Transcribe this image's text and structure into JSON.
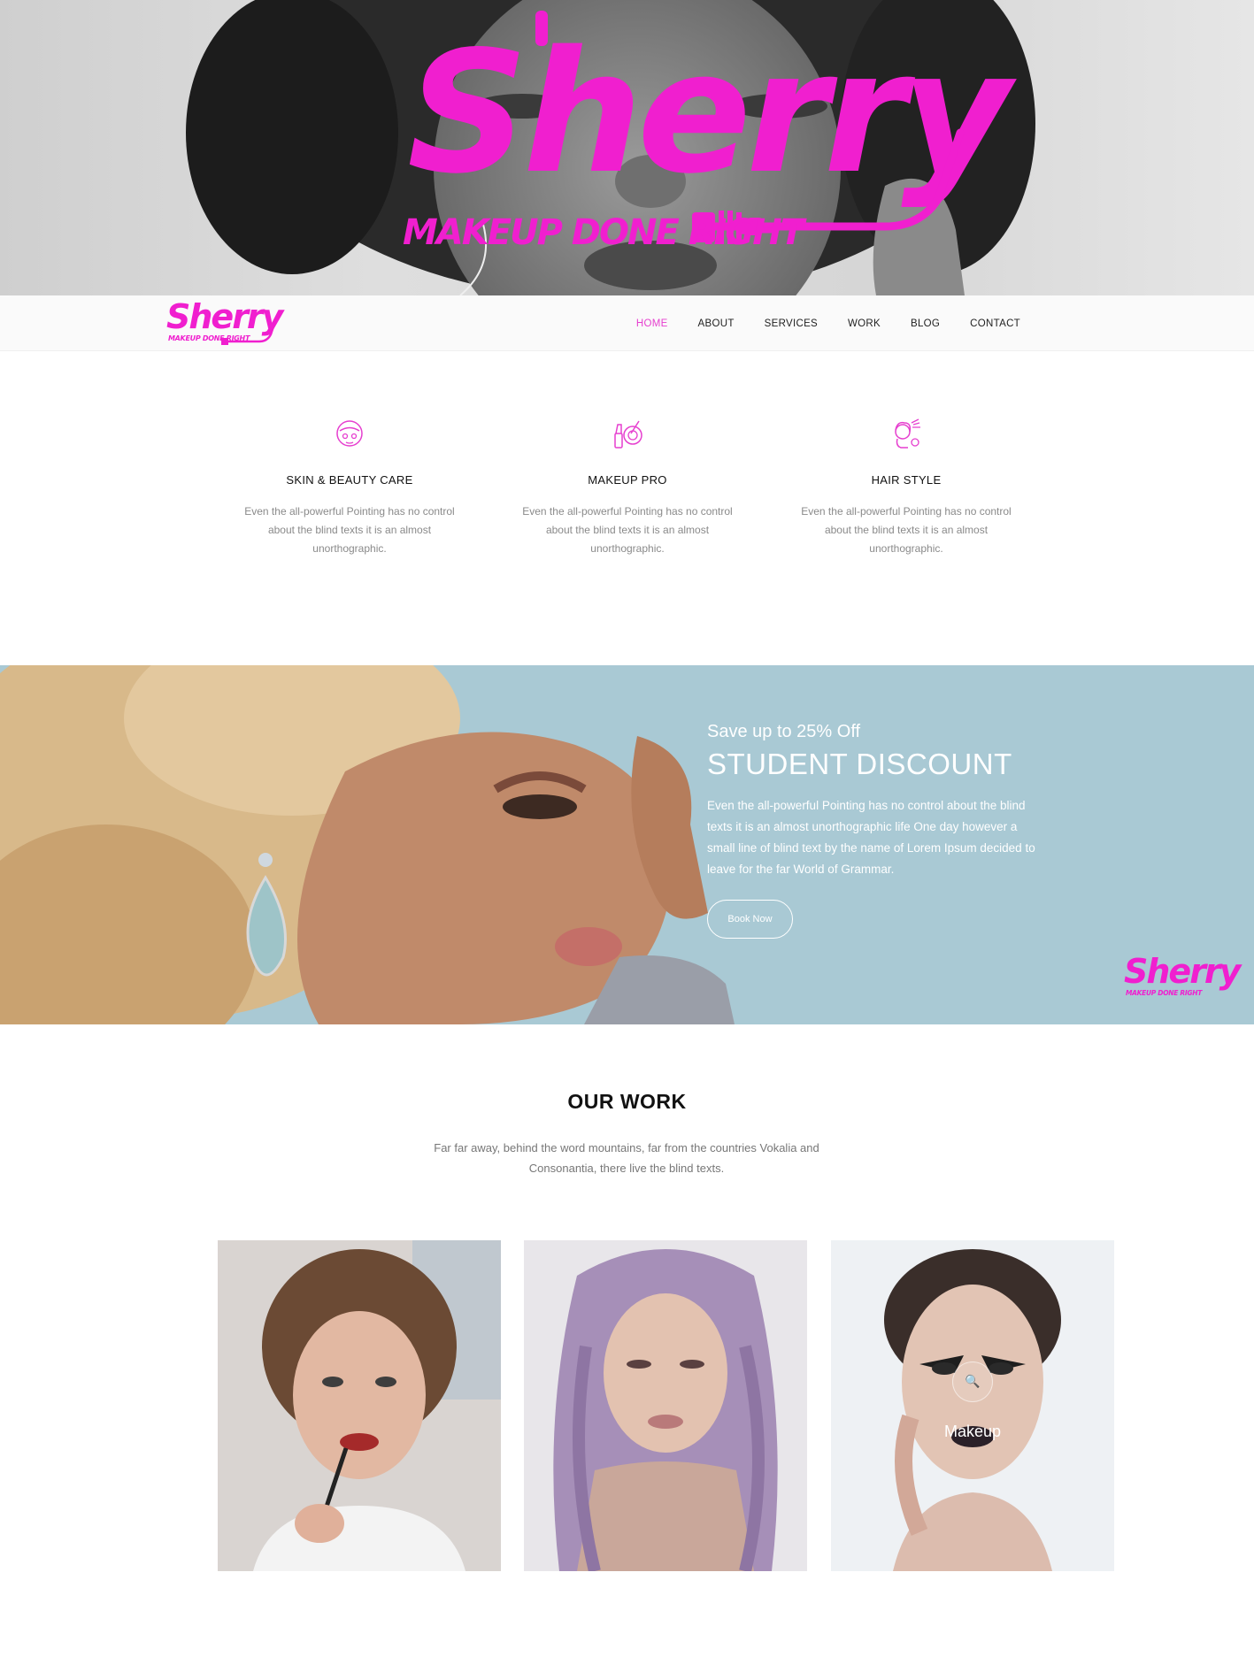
{
  "brand": {
    "name": "Sherry",
    "tagline": "MAKEUP DONE RIGHT",
    "accent_color": "#f01fcf"
  },
  "nav": {
    "items": [
      {
        "label": "HOME",
        "active": true
      },
      {
        "label": "ABOUT",
        "active": false
      },
      {
        "label": "SERVICES",
        "active": false
      },
      {
        "label": "WORK",
        "active": false
      },
      {
        "label": "BLOG",
        "active": false
      },
      {
        "label": "CONTACT",
        "active": false
      }
    ]
  },
  "services": [
    {
      "icon": "face-mask-icon",
      "title": "SKIN & BEAUTY CARE",
      "text": "Even the all-powerful Pointing has no control about the blind texts it is an almost unorthographic."
    },
    {
      "icon": "makeup-kit-icon",
      "title": "MAKEUP PRO",
      "text": "Even the all-powerful Pointing has no control about the blind texts it is an almost unorthographic."
    },
    {
      "icon": "hair-style-icon",
      "title": "HAIR STYLE",
      "text": "Even the all-powerful Pointing has no control about the blind texts it is an almost unorthographic."
    }
  ],
  "promo": {
    "subtitle": "Save up to 25% Off",
    "title": "STUDENT DISCOUNT",
    "text": "Even the all-powerful Pointing has no control about the blind texts it is an almost unorthographic life One day however a small line of blind text by the name of Lorem Ipsum decided to leave for the far World of Grammar.",
    "button_label": "Book Now",
    "background_color": "#a9c9d4"
  },
  "work": {
    "title": "OUR WORK",
    "subtitle": "Far far away, behind the word mountains, far from the countries Vokalia and Consonantia, there live the blind texts.",
    "items": [
      {
        "label": ""
      },
      {
        "label": ""
      },
      {
        "label": "Makeup",
        "hover_icon": "search-icon"
      }
    ]
  }
}
